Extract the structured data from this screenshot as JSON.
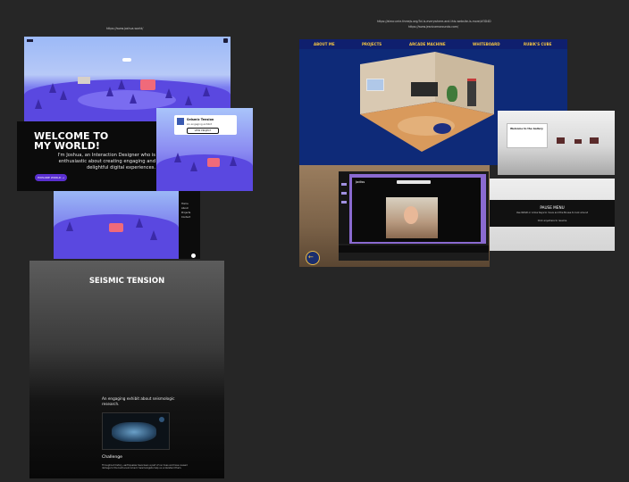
{
  "urls": {
    "left": "https://www.joshua.world/",
    "right_line1": "https://alexcurrie.threejs.org/3d-is-everywhere-and-this-website-is-more/#3D4D",
    "right_line2": "https://www.jesnicamoroundo.com/"
  },
  "joshua": {
    "hero_title": "WELCOME TO MY WORLD!",
    "hero_text": "I'm Joshua, an Interaction Designer who is enthusiastic about creating engaging and delightful digital experiences.",
    "hero_button": "EXPLORE WORLD →",
    "card_title": "Seismic Tension",
    "card_subtitle": "An engaging exhibit",
    "card_button": "VIEW PROJECT",
    "menu_items": [
      "Home",
      "About",
      "Projects",
      "Contact"
    ]
  },
  "seismic": {
    "title": "SEISMIC TENSION",
    "tagline": "An engaging exhibit about seismologic research.",
    "section_heading": "Challenge",
    "body": "Throughout history, earthquakes have been a part of our lives and have caused damage to the built environment. Seismologists help us understand them."
  },
  "room": {
    "nav": [
      "ABOUT ME",
      "PROJECTS",
      "ARCADE MACHINE",
      "WHITEBOARD",
      "RUBIK'S CUBE"
    ],
    "app_title": "Jadiss",
    "pause_title": "PAUSE MENU",
    "pause_text": "Use WASD or Arrow Keys to move and the Mouse to look around",
    "pause_link": "Click anywhere to resume",
    "panel_heading": "Welcome to the Gallery"
  },
  "colors": {
    "background": "#262626",
    "room_nav": "#0f1f6e",
    "room_nav_text": "#f5c542",
    "world_sky": "#8fb0f5",
    "world_ground": "#5a48e0",
    "hero_bg": "#0b0b0b",
    "button_purple": "#5a2fd0"
  }
}
